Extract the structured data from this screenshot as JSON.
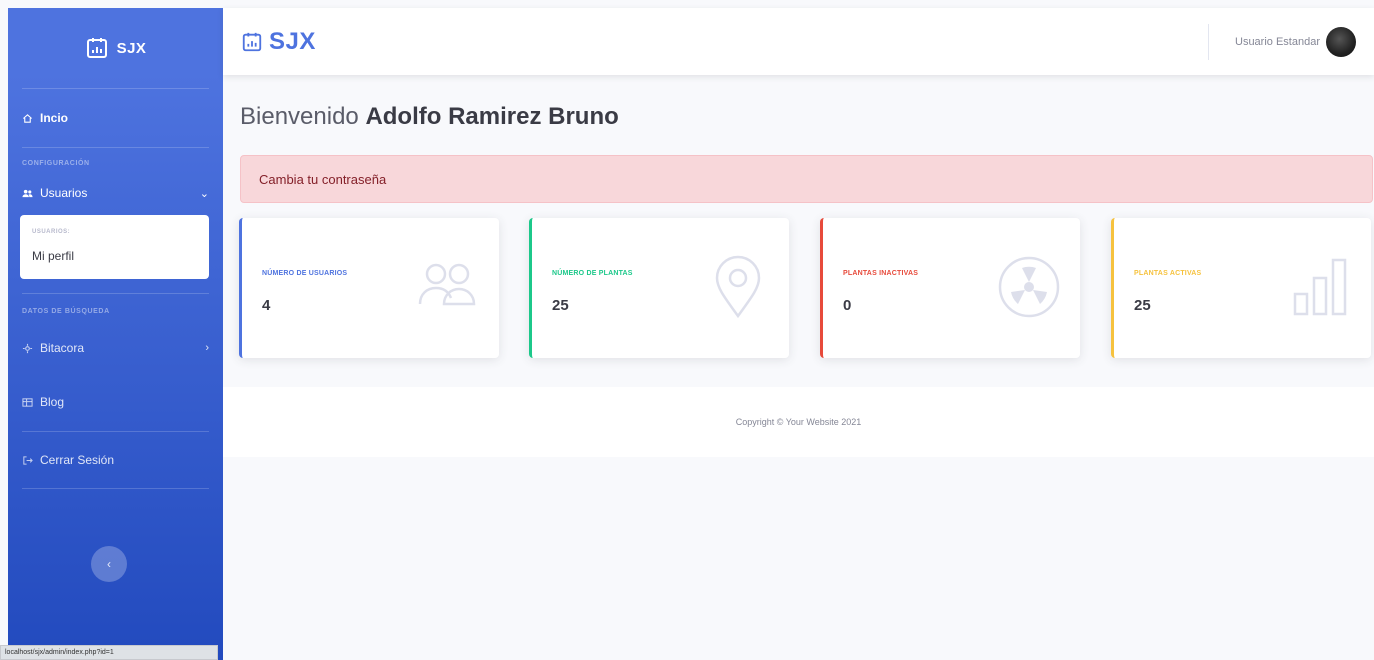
{
  "brand": {
    "name": "SJX",
    "top_name": "SJX"
  },
  "sidebar": {
    "home_label": "Incio",
    "heading_config": "CONFIGURACIÓN",
    "users_label": "Usuarios",
    "collapse_header": "USUARIOS:",
    "profile_label": "Mi perfil",
    "heading_search": "DATOS DE BÚSQUEDA",
    "bitacora_label": "Bitacora",
    "blog_label": "Blog",
    "logout_label": "Cerrar Sesión",
    "status_url": "localhost/sjx/admin/index.php?id=1"
  },
  "topbar": {
    "user_label": "Usuario Estandar"
  },
  "main": {
    "welcome_prefix": "Bienvenido",
    "user_name": "Adolfo Ramirez Bruno",
    "alert_text": "Cambia tu contraseña",
    "cards": [
      {
        "label": "NÚMERO DE USUARIOS",
        "value": "4",
        "icon": "users-icon",
        "color": "#4e73df"
      },
      {
        "label": "NÚMERO DE PLANTAS",
        "value": "25",
        "icon": "map-marker-icon",
        "color": "#1cc88a"
      },
      {
        "label": "PLANTAS INACTIVAS",
        "value": "0",
        "icon": "radiation-icon",
        "color": "#e74a3b"
      },
      {
        "label": "PLANTAS ACTIVAS",
        "value": "25",
        "icon": "bar-chart-icon",
        "color": "#f6c23e"
      }
    ],
    "footer": "Copyright © Your Website 2021"
  }
}
